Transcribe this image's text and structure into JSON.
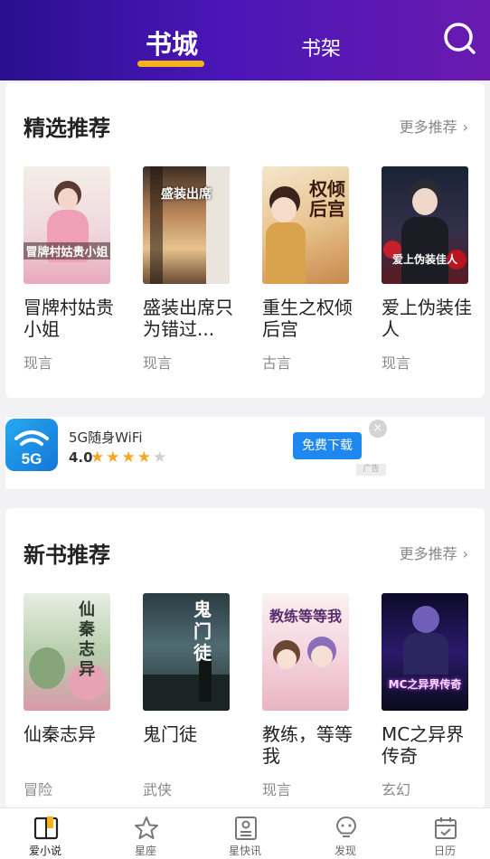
{
  "header": {
    "tabs": [
      {
        "label": "书城",
        "active": true
      },
      {
        "label": "书架",
        "active": false
      }
    ],
    "search_icon": "search-icon",
    "accent_color": "#f6b21a"
  },
  "featured": {
    "title": "精选推荐",
    "more_label": "更多推荐",
    "books": [
      {
        "title": "冒牌村姑贵小姐",
        "tag": "现言",
        "cover_text": "冒牌村姑贵小姐"
      },
      {
        "title": "盛装出席只为错过...",
        "tag": "现言",
        "cover_text": "盛装出席"
      },
      {
        "title": "重生之权倾后宫",
        "tag": "古言",
        "cover_text": "权倾后宫"
      },
      {
        "title": "爱上伪装佳人",
        "tag": "现言",
        "cover_text": "爱上伪装佳人"
      }
    ]
  },
  "ad": {
    "app_name": "5G随身WiFi",
    "rating": "4.0",
    "stars_filled": 4,
    "stars_total": 5,
    "button_label": "免费下载",
    "icon_text": "5G",
    "ad_mark": "广告",
    "close_symbol": "×"
  },
  "new_books": {
    "title": "新书推荐",
    "more_label": "更多推荐",
    "books": [
      {
        "title": "仙秦志异",
        "tag": "冒险",
        "cover_text": "仙秦志异"
      },
      {
        "title": "鬼门徒",
        "tag": "武侠",
        "cover_text": "鬼门徒"
      },
      {
        "title": "教练，等等我",
        "tag": "现言",
        "cover_text": "教练等等我"
      },
      {
        "title": "MC之异界传奇",
        "tag": "玄幻",
        "cover_text": "MC之异界传奇"
      }
    ]
  },
  "bottom_nav": [
    {
      "label": "爱小说",
      "icon": "book-icon",
      "active": true
    },
    {
      "label": "星座",
      "icon": "star-icon",
      "active": false
    },
    {
      "label": "星快讯",
      "icon": "news-icon",
      "active": false
    },
    {
      "label": "发现",
      "icon": "bulb-icon",
      "active": false
    },
    {
      "label": "日历",
      "icon": "calendar-icon",
      "active": false
    }
  ]
}
